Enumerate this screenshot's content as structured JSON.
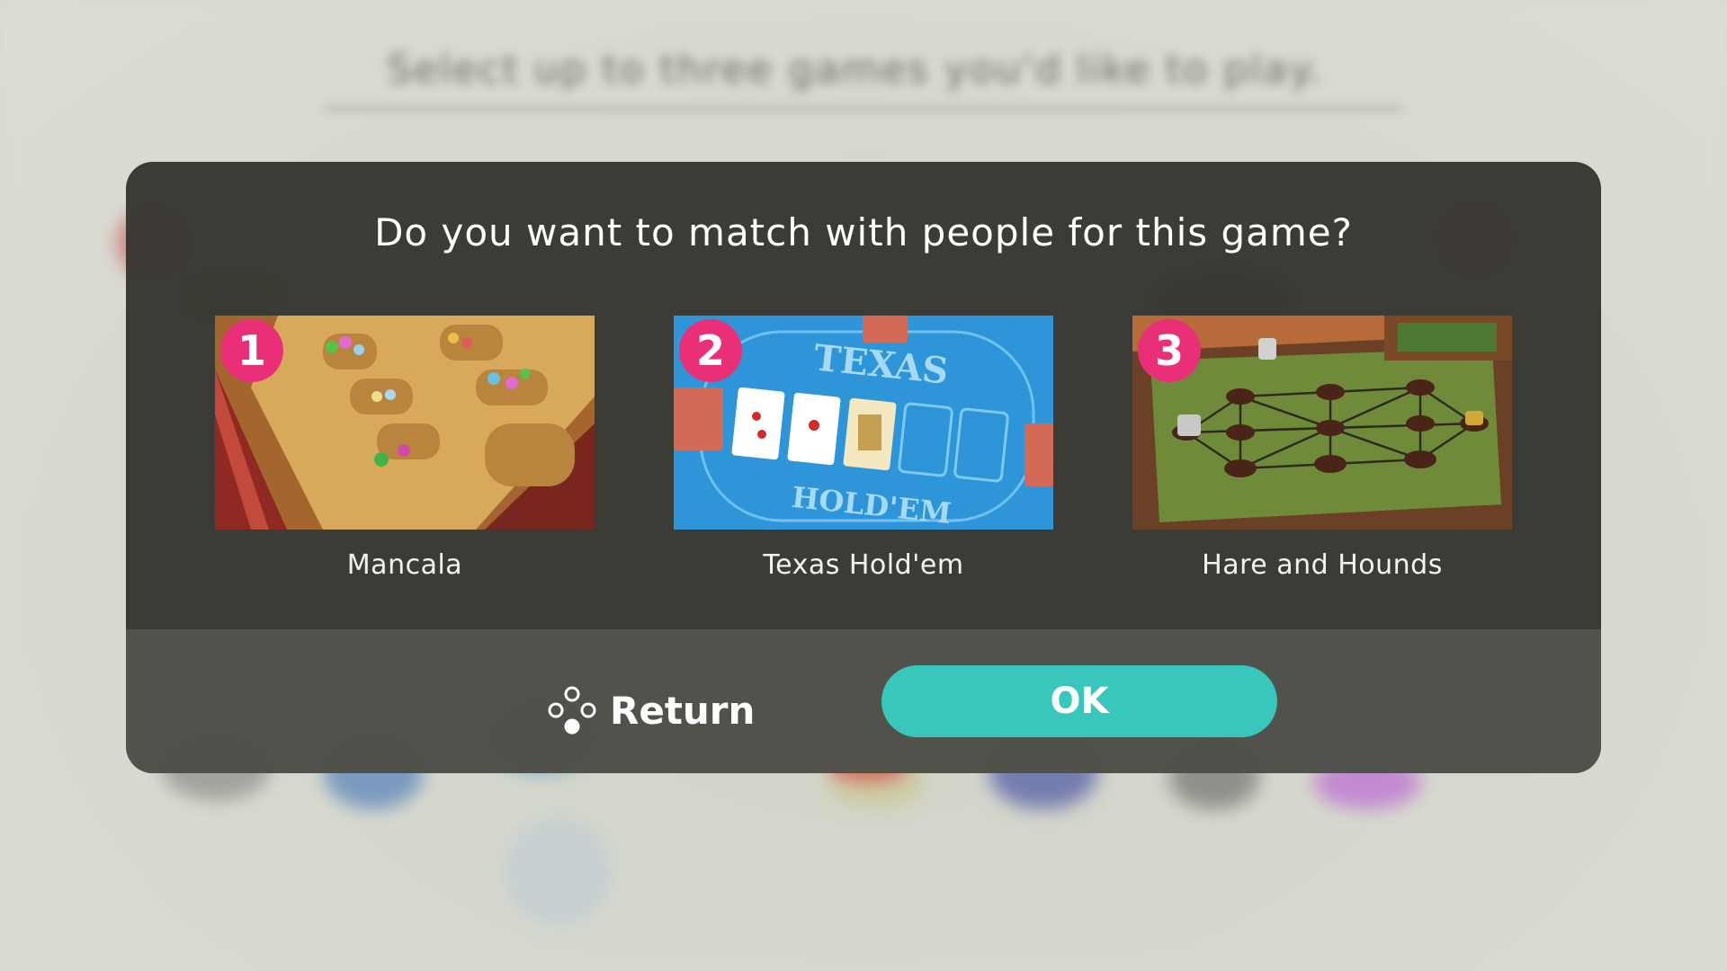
{
  "background": {
    "prompt": "Select up to three games you'd like to play."
  },
  "dialog": {
    "question": "Do you want to match with people for this game?",
    "games": [
      {
        "rank": "1",
        "name": "Mancala",
        "thumb_icon": "mancala-board-thumbnail"
      },
      {
        "rank": "2",
        "name": "Texas Hold'em",
        "thumb_icon": "poker-table-thumbnail",
        "table_text_top": "TEXAS",
        "table_text_bottom": "HOLD'EM"
      },
      {
        "rank": "3",
        "name": "Hare and Hounds",
        "thumb_icon": "hare-hounds-board-thumbnail"
      }
    ],
    "return_label": "Return",
    "return_icon": "controller-buttons-icon",
    "ok_label": "OK"
  },
  "colors": {
    "modal": "#34342e",
    "badge": "#ea2f79",
    "ok_button": "#39c7bd"
  }
}
